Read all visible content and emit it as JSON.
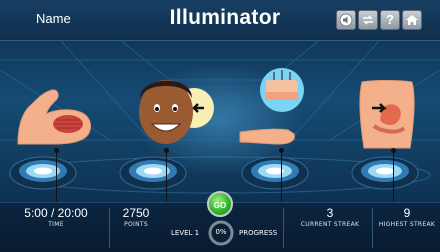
{
  "header": {
    "name_label": "Name",
    "title": "Illuminator",
    "buttons": [
      "audio-icon",
      "swap-icon",
      "help-icon",
      "home-icon"
    ],
    "help_label": "?"
  },
  "scene": {
    "figures": [
      "flexed-arm-muscle",
      "smiling-boy-face",
      "hand-skin-layers",
      "torso-stomach"
    ]
  },
  "stats": {
    "time_value": "5:00 / 20:00",
    "time_label": "TIME",
    "points_value": "2750",
    "points_label": "POINTS",
    "level_label": "LEVEL 1",
    "progress_value": "0%",
    "progress_label": "PROGRESS",
    "current_streak_value": "3",
    "current_streak_label": "CURRENT STREAK",
    "highest_streak_value": "9",
    "highest_streak_label": "HIGHEST STREAK"
  },
  "go_button": "GO",
  "colors": {
    "header_bg": "#133656",
    "go_green": "#33b52f",
    "skin": "#f3b08a",
    "pedestal_glow": "#5ec6f0"
  }
}
